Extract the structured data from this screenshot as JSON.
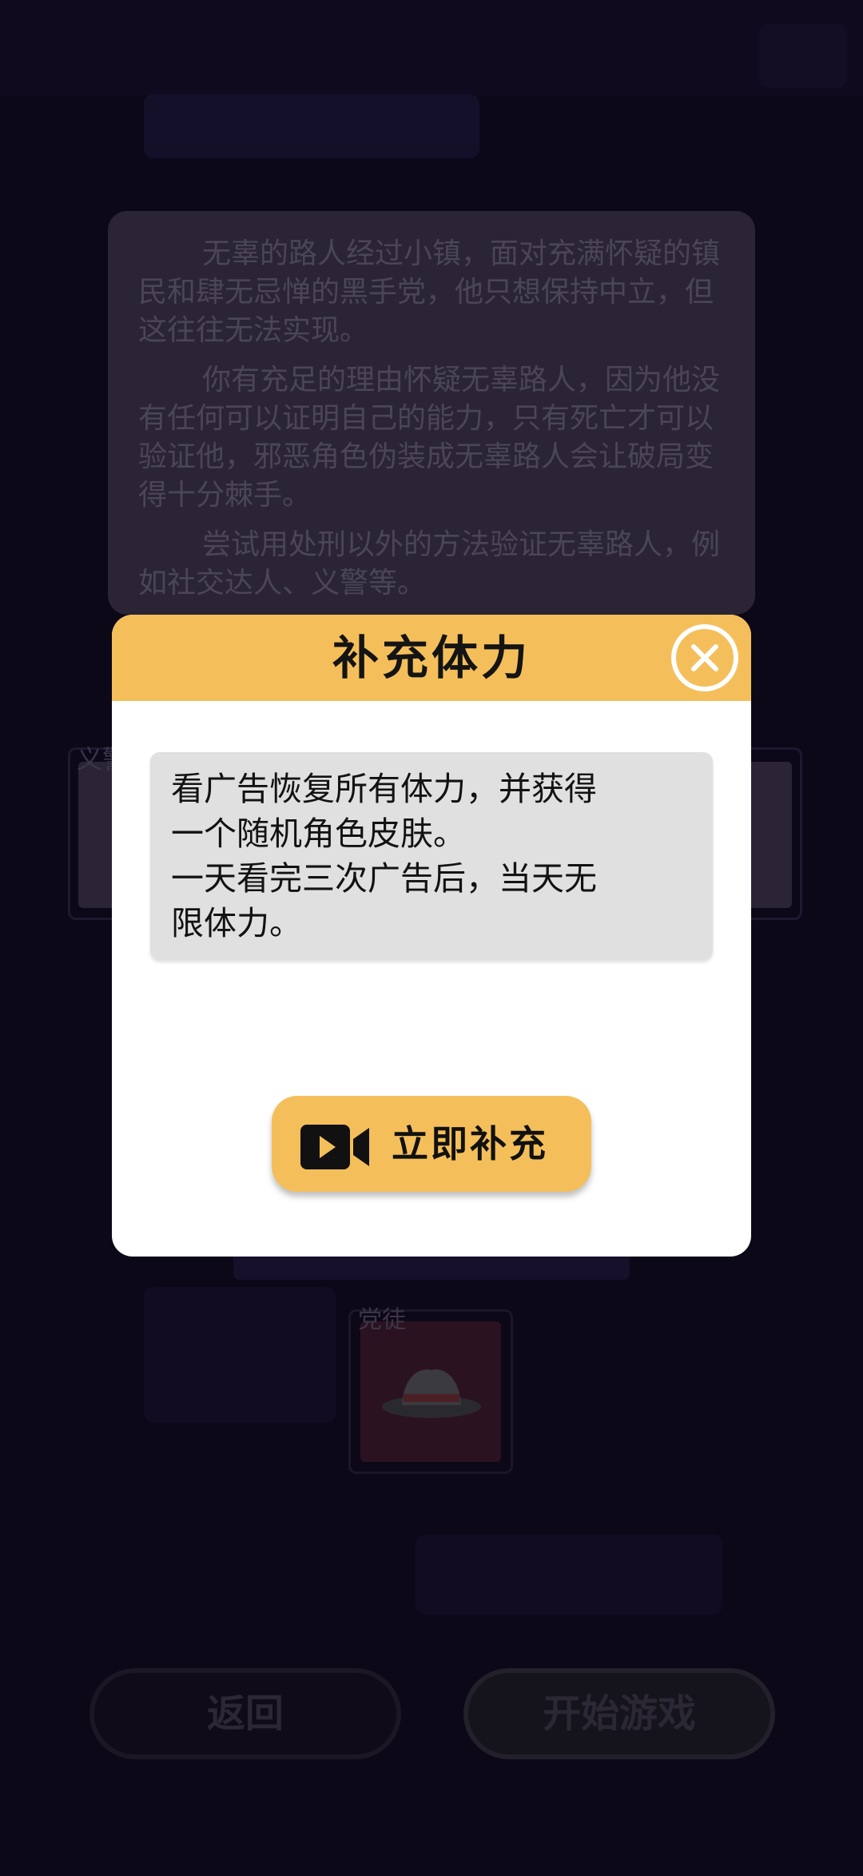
{
  "background": {
    "description_paragraphs": [
      "无辜的路人经过小镇，面对充满怀疑的镇民和肆无忌惮的黑手党，他只想保持中立，但这往往无法实现。",
      "你有充足的理由怀疑无辜路人，因为他没有任何可以证明自己的能力，只有死亡才可以验证他，邪恶角色伪装成无辜路人会让破局变得十分棘手。",
      "尝试用处刑以外的方法验证无辜路人，例如社交达人、义警等。"
    ],
    "left_role_label": "义警",
    "party_label": "党徒",
    "back_button": "返回",
    "start_button": "开始游戏"
  },
  "modal": {
    "title": "补充体力",
    "body_lines": [
      "看广告恢复所有体力，并获得",
      "一个随机角色皮肤。",
      "一天看完三次广告后，当天无",
      "限体力。"
    ],
    "action_label": "立即补充",
    "action_icon": "video-camera-icon",
    "close_icon": "close-icon"
  },
  "colors": {
    "accent": "#f4bf5b",
    "page_bg": "#0c0818"
  }
}
